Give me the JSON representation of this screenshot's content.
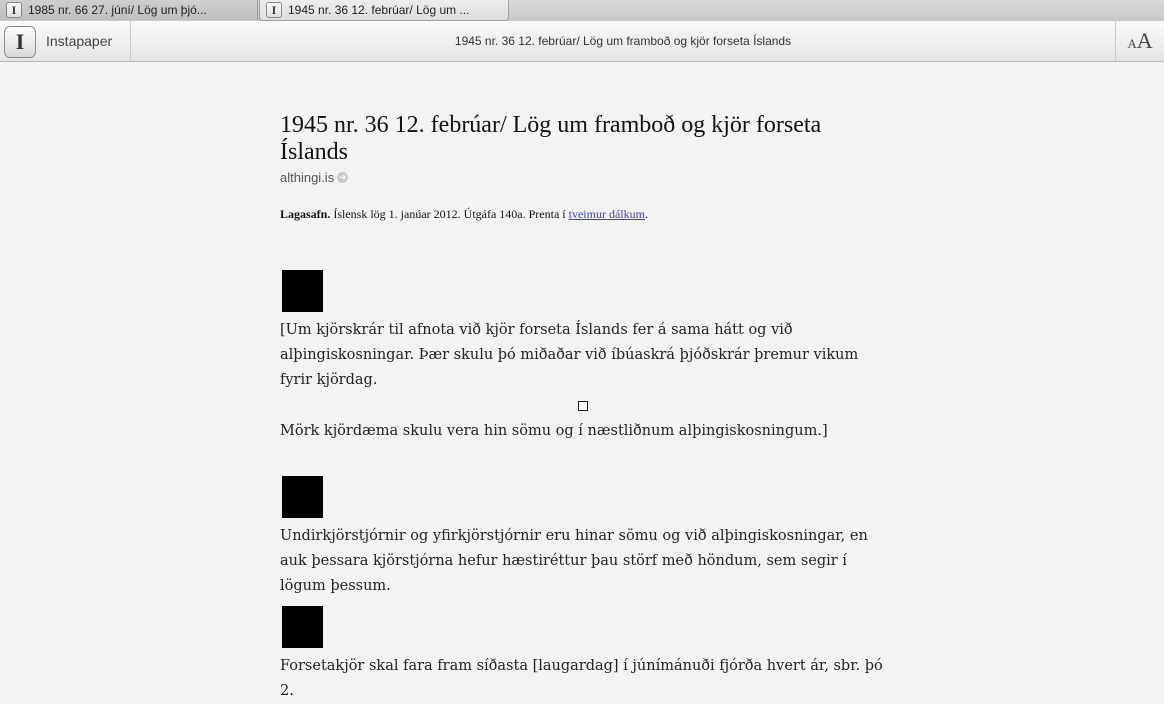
{
  "tabs": [
    {
      "label": "1985 nr. 66 27. júní/ Lög um þjó..."
    },
    {
      "label": "1945 nr. 36 12. febrúar/ Lög um ..."
    }
  ],
  "toolbar": {
    "app_logo": "I",
    "app_name": "Instapaper",
    "title": "1945 nr. 36 12. febrúar/ Lög um framboð og kjör forseta Íslands",
    "font_small": "A",
    "font_large": "A"
  },
  "article": {
    "title": "1945 nr. 36 12. febrúar/ Lög um framboð og kjör forseta Íslands",
    "source": "althingi.is",
    "meta_bold": "Lagasafn.",
    "meta_text": " Íslensk lög 1. janúar 2012.  Útgáfa 140a.  Prenta í ",
    "meta_link": "tveimur dálkum",
    "meta_end": ".",
    "paragraphs": [
      "[Um kjörskrár til afnota við kjör forseta Íslands fer á sama hátt og við alþingiskosningar. Þær skulu þó miðaðar við íbúaskrá þjóðskrár þremur vikum fyrir kjördag.",
      "Mörk kjördæma skulu vera hin sömu og í næstliðnum alþingiskosningum.]",
      "Undirkjörstjórnir og yfirkjörstjórnir eru hinar sömu og við alþingiskosningar, en auk þessara kjörstjórna hefur hæstiréttur þau störf með höndum, sem segir í lögum þessum.",
      "Forsetakjör skal fara fram síðasta [laugardag] í júnímánuði fjórða hvert ár, sbr. þó 2."
    ]
  },
  "icons": {
    "source_arrow": "arrow-right-icon"
  }
}
